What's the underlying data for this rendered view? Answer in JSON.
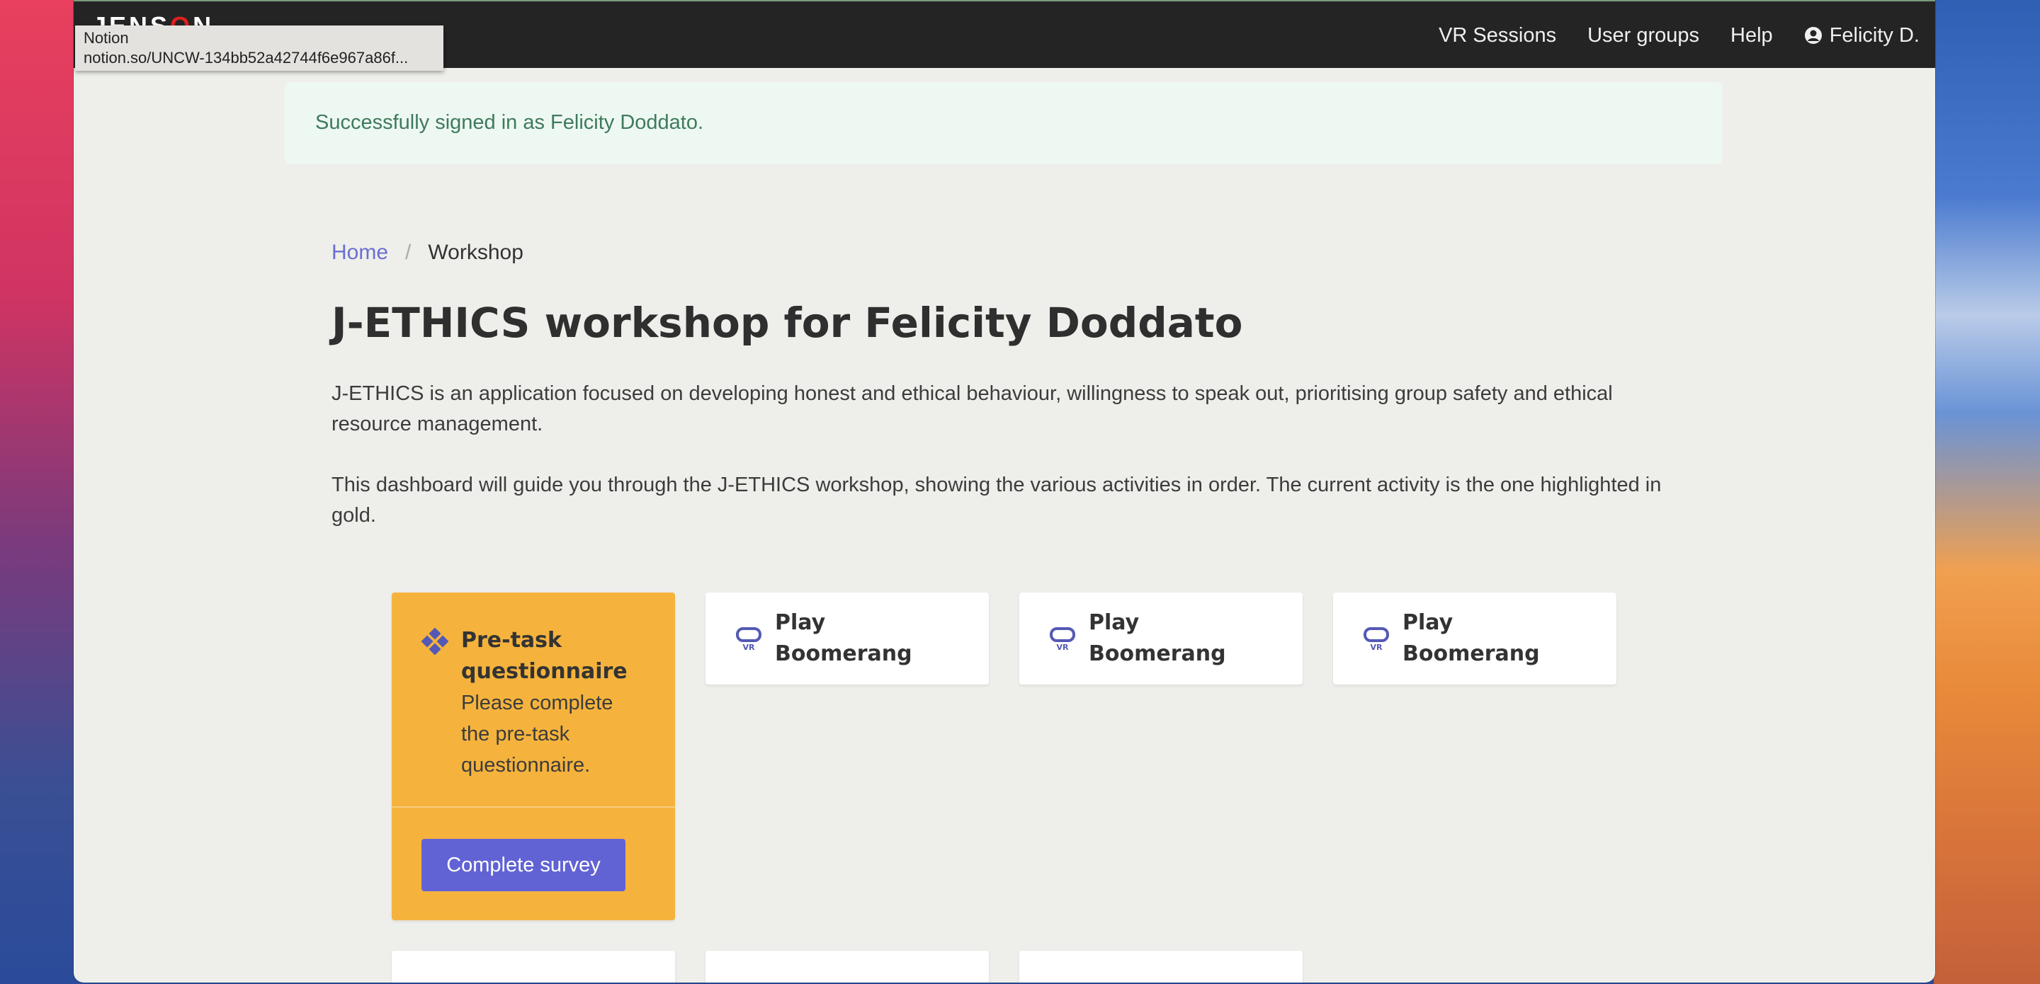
{
  "navbar": {
    "brand_left": "JENS",
    "brand_o": "O",
    "brand_right": "N",
    "links": [
      "VR Sessions",
      "User groups",
      "Help"
    ],
    "user_label": "Felicity D."
  },
  "tooltip": {
    "line1": "Notion",
    "line2": "notion.so/UNCW-134bb52a42744f6e967a86f..."
  },
  "alert": {
    "text": "Successfully signed in as Felicity Doddato."
  },
  "breadcrumb": {
    "home": "Home",
    "separator": "/",
    "current": "Workshop"
  },
  "page": {
    "title": "J-ETHICS workshop for Felicity Doddato",
    "description_1": "J-ETHICS is an application focused on developing honest and ethical behaviour, willingness to speak out, prioritising group safety and ethical resource management.",
    "description_2": "This dashboard will guide you through the J-ETHICS workshop, showing the various activities in order. The current activity is the one highlighted in gold."
  },
  "activities": [
    {
      "title": "Pre-task questionnaire",
      "text": "Please complete the pre-task questionnaire.",
      "button": "Complete survey",
      "icon": "diamond-cluster-icon",
      "highlight_color": "#f5b33d"
    },
    {
      "title": "Play Boomerang",
      "icon": "vr-headset-icon"
    },
    {
      "title": "Play Boomerang",
      "icon": "vr-headset-icon"
    },
    {
      "title": "Play Boomerang",
      "icon": "vr-headset-icon"
    }
  ],
  "colors": {
    "accent": "#6163d4",
    "navbar": "#242424",
    "alert_bg": "#eef8f2",
    "alert_text": "#3e7a5c"
  }
}
